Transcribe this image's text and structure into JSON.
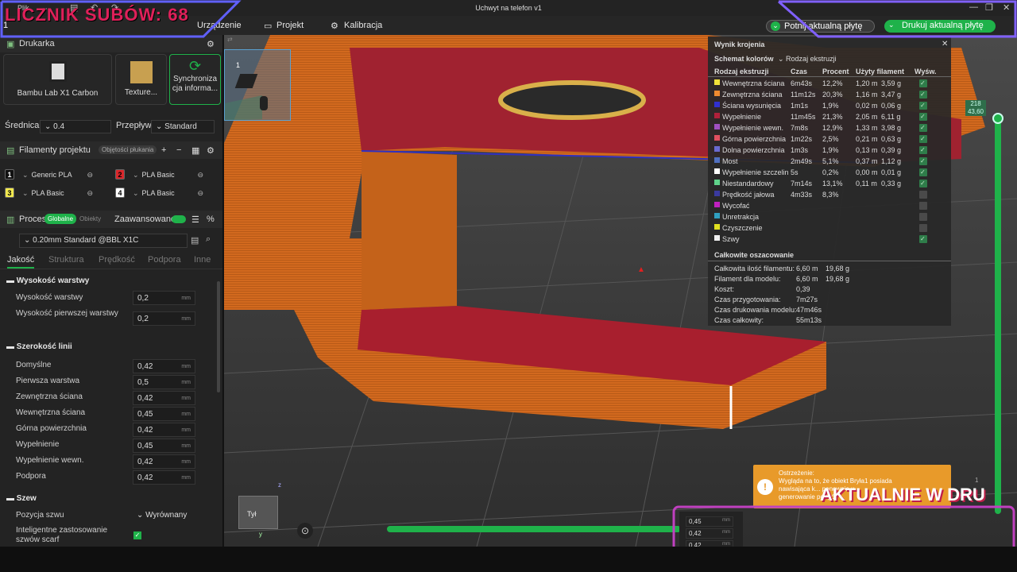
{
  "window": {
    "title": "Uchwyt na telefon v1",
    "menu": "Plik"
  },
  "counter": "LICZNIK SUBÓW: 68",
  "nav": {
    "device": "Urządzenie",
    "project": "Projekt",
    "calibration": "Kalibracja"
  },
  "actions": {
    "slice": "Potnij aktualną płytę",
    "print": "Drukuj aktualną płytę"
  },
  "printer": {
    "section": "Drukarka",
    "name": "Bambu Lab X1 Carbon",
    "texture": "Texture...",
    "sync": "Synchroniza cja informa...",
    "diameter_label": "Średnica",
    "diameter": "0.4",
    "flow_label": "Przepływ",
    "flow": "Standard"
  },
  "filaments": {
    "section": "Filamenty projektu",
    "badge": "Objętości płukania",
    "items": [
      {
        "n": "1",
        "name": "Generic PLA",
        "color": "#111111"
      },
      {
        "n": "2",
        "name": "PLA Basic",
        "color": "#d9262a"
      },
      {
        "n": "3",
        "name": "PLA Basic",
        "color": "#f2e94e"
      },
      {
        "n": "4",
        "name": "PLA Basic",
        "color": "#ffffff"
      }
    ]
  },
  "process": {
    "section": "Proces",
    "global": "Globalne",
    "objects": "Obiekty",
    "advanced": "Zaawansowane",
    "preset": "0.20mm Standard @BBL X1C",
    "tabs": [
      "Jakość",
      "Struktura",
      "Prędkość",
      "Podpora",
      "Inne"
    ]
  },
  "settings": {
    "layer_group": "Wysokość warstwy",
    "layer_height": "Wysokość warstwy",
    "layer_height_val": "0,2",
    "first_layer": "Wysokość pierwszej warstwy",
    "first_layer_val": "0,2",
    "width_group": "Szerokość linii",
    "unit": "mm",
    "rows": [
      {
        "label": "Domyślne",
        "value": "0,42"
      },
      {
        "label": "Pierwsza warstwa",
        "value": "0,5"
      },
      {
        "label": "Zewnętrzna ściana",
        "value": "0,42"
      },
      {
        "label": "Wewnętrzna ściana",
        "value": "0,45"
      },
      {
        "label": "Górna powierzchnia",
        "value": "0,42"
      },
      {
        "label": "Wypełnienie",
        "value": "0,45"
      },
      {
        "label": "Wypełnienie wewn.",
        "value": "0,42"
      },
      {
        "label": "Podpora",
        "value": "0,42"
      }
    ],
    "seam_group": "Szew",
    "seam_pos": "Pozycja szwu",
    "seam_pos_val": "Wyrównany",
    "scarf": "Inteligentne zastosowanie szwów scarf"
  },
  "slice": {
    "title": "Wynik krojenia",
    "scheme_label": "Schemat kolorów",
    "scheme": "Rodzaj ekstruzji",
    "headers": [
      "Rodzaj ekstruzji",
      "Czas",
      "Procent",
      "Użyty filament",
      "Wyśw."
    ],
    "rows": [
      {
        "name": "Wewnętrzna ściana",
        "color": "#f2e13a",
        "time": "6m43s",
        "pct": "12,2%",
        "len": "1,20 m",
        "wt": "3,59 g",
        "on": true
      },
      {
        "name": "Zewnętrzna ściana",
        "color": "#ef8a30",
        "time": "11m12s",
        "pct": "20,3%",
        "len": "1,16 m",
        "wt": "3,47 g",
        "on": true
      },
      {
        "name": "Ściana wysunięcia",
        "color": "#3030d0",
        "time": "1m1s",
        "pct": "1,9%",
        "len": "0,02 m",
        "wt": "0,06 g",
        "on": true
      },
      {
        "name": "Wypełnienie",
        "color": "#b0203a",
        "time": "11m45s",
        "pct": "21,3%",
        "len": "2,05 m",
        "wt": "6,11 g",
        "on": true
      },
      {
        "name": "Wypełnienie wewn.",
        "color": "#a050c0",
        "time": "7m8s",
        "pct": "12,9%",
        "len": "1,33 m",
        "wt": "3,98 g",
        "on": true
      },
      {
        "name": "Górna powierzchnia",
        "color": "#e05060",
        "time": "1m22s",
        "pct": "2,5%",
        "len": "0,21 m",
        "wt": "0,63 g",
        "on": true
      },
      {
        "name": "Dolna powierzchnia",
        "color": "#6a6ad0",
        "time": "1m3s",
        "pct": "1,9%",
        "len": "0,13 m",
        "wt": "0,39 g",
        "on": true
      },
      {
        "name": "Most",
        "color": "#5070c0",
        "time": "2m49s",
        "pct": "5,1%",
        "len": "0,37 m",
        "wt": "1,12 g",
        "on": true
      },
      {
        "name": "Wypełnienie szczelin",
        "color": "#ffffff",
        "time": "5s",
        "pct": "0,2%",
        "len": "0,00 m",
        "wt": "0,01 g",
        "on": true
      },
      {
        "name": "Niestandardowy",
        "color": "#5fd38a",
        "time": "7m14s",
        "pct": "13,1%",
        "len": "0,11 m",
        "wt": "0,33 g",
        "on": true
      },
      {
        "name": "Prędkość jałowa",
        "color": "#3a3aa0",
        "time": "4m33s",
        "pct": "8,3%",
        "len": "",
        "wt": "",
        "on": false
      },
      {
        "name": "Wycofać",
        "color": "#c020c0",
        "time": "",
        "pct": "",
        "len": "",
        "wt": "",
        "on": false
      },
      {
        "name": "Unretrakcja",
        "color": "#30a0c0",
        "time": "",
        "pct": "",
        "len": "",
        "wt": "",
        "on": false
      },
      {
        "name": "Czyszczenie",
        "color": "#e0e020",
        "time": "",
        "pct": "",
        "len": "",
        "wt": "",
        "on": false
      },
      {
        "name": "Szwy",
        "color": "#f0f0f0",
        "time": "",
        "pct": "",
        "len": "",
        "wt": "",
        "on": true
      }
    ],
    "est_title": "Całkowite oszacowanie",
    "est": [
      {
        "l": "Całkowita ilość filamentu:",
        "a": "6,60 m",
        "b": "19,68 g"
      },
      {
        "l": "Filament dla modelu:",
        "a": "6,60 m",
        "b": "19,68 g"
      },
      {
        "l": "Koszt:",
        "a": "0,39",
        "b": ""
      },
      {
        "l": "Czas przygotowania:",
        "a": "7m27s",
        "b": ""
      },
      {
        "l": "Czas drukowania modelu:",
        "a": "47m46s",
        "b": ""
      },
      {
        "l": "Czas całkowity:",
        "a": "55m13s",
        "b": ""
      }
    ]
  },
  "layer": {
    "top": "218",
    "top2": "43,60",
    "bottom": "1"
  },
  "plate": "1",
  "warning": {
    "title": "Ostrzeżenie:",
    "text": "Wygląda na to, że obiekt Bryła1 posiada nawisająca k... ponownie u... generowanie podpór."
  },
  "banner": "AKTUALNIE W DRU",
  "corner": {
    "values": [
      "0,45",
      "0,42",
      "0,42"
    ],
    "unit": "mm"
  },
  "axes": {
    "x": "x",
    "y": "y",
    "z": "z",
    "cube": "Tył"
  }
}
